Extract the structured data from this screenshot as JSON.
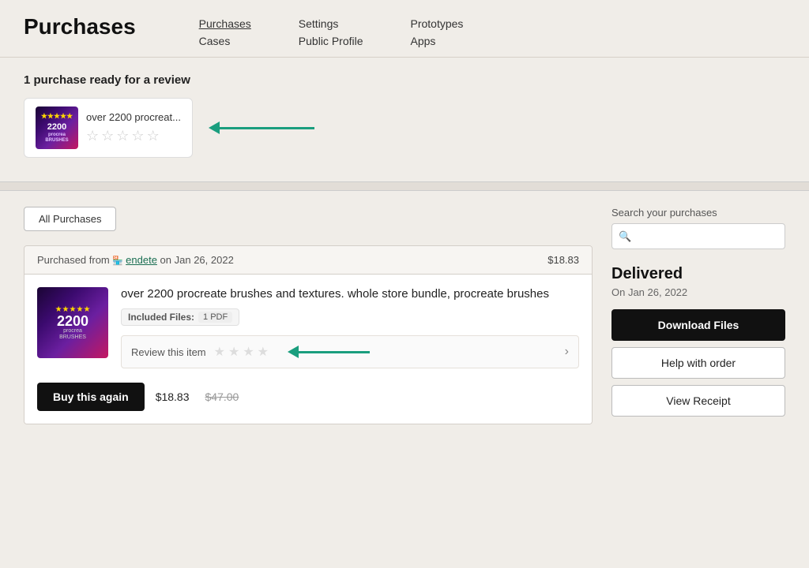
{
  "header": {
    "title": "Purchases",
    "nav": [
      {
        "col": [
          {
            "label": "Purchases",
            "active": true
          },
          {
            "label": "Cases",
            "active": false
          }
        ]
      },
      {
        "col": [
          {
            "label": "Settings",
            "active": false
          },
          {
            "label": "Public Profile",
            "active": false
          }
        ]
      },
      {
        "col": [
          {
            "label": "Prototypes",
            "active": false
          },
          {
            "label": "Apps",
            "active": false
          }
        ]
      }
    ]
  },
  "review_section": {
    "title": "1 purchase ready for a review",
    "product_name": "over 2200 procreat...",
    "stars": [
      "☆",
      "☆",
      "☆",
      "☆",
      "☆"
    ]
  },
  "filter": {
    "label": "All Purchases"
  },
  "purchase": {
    "from_label": "Purchased from",
    "shop_icon": "🏪",
    "shop_name": "endete",
    "date": "on Jan 26, 2022",
    "price": "$18.83",
    "item_title": "over 2200 procreate brushes and textures. whole store bundle, procreate brushes",
    "included_files_label": "Included Files:",
    "included_files_value": "1 PDF",
    "review_label": "Review this item",
    "review_stars": [
      "★",
      "★",
      "★",
      "★"
    ],
    "buy_again_label": "Buy this again",
    "price_current": "$18.83",
    "price_original": "$47.00"
  },
  "sidebar": {
    "search_label": "Search your purchases",
    "search_placeholder": "🔍",
    "delivered_title": "Delivered",
    "delivered_date": "On Jan 26, 2022",
    "download_label": "Download Files",
    "help_label": "Help with order",
    "receipt_label": "View Receipt"
  }
}
